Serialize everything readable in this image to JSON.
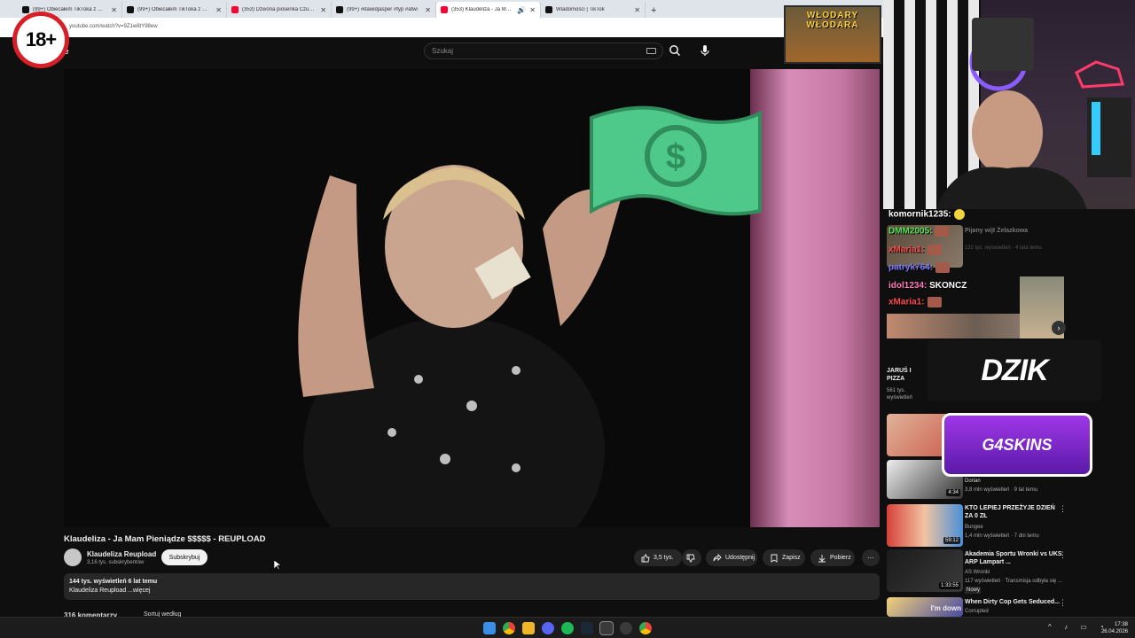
{
  "browser": {
    "tabs": [
      {
        "title": "(99+) Obiecałem TikToka z @La",
        "icon": "tiktok",
        "active": false
      },
      {
        "title": "(99+) Obiecałem TikToka z @La",
        "icon": "tiktok",
        "active": false
      },
      {
        "title": "(353) Dzwona piosenka Czukcza",
        "icon": "youtube",
        "active": false
      },
      {
        "title": "(99+) #dawidjasper #fyp #atwi",
        "icon": "tiktok",
        "active": false
      },
      {
        "title": "(353) Klaudeliza - Ja Mam P",
        "icon": "youtube",
        "active": true
      },
      {
        "title": "Wiadomości | TikTok",
        "icon": "tiktok",
        "active": false
      }
    ],
    "new_tab_label": "+",
    "url": "youtube.com/watch?v=9Z1w8tY98ew"
  },
  "overlay": {
    "age_badge": "18+",
    "banner_text": "WŁODARY WŁODARA",
    "dzik_logo": "DZIK",
    "g4skins_logo": "G4SKINS"
  },
  "youtube": {
    "logo_suffix": "e",
    "search_placeholder": "Szukaj",
    "video_title": "Klaudeliza - Ja Mam Pieniądze $$$$$ - REUPLOAD",
    "channel_name": "Klaudeliza Reupload",
    "channel_subs": "3,16 tys. subskrybentów",
    "subscribe_label": "Subskrybuj",
    "likes": "3,5 tys.",
    "share_label": "Udostępnij",
    "save_label": "Zapisz",
    "download_label": "Pobierz",
    "description_line1": "144 tys. wyświetleń  6 lat temu",
    "description_line2": "Klaudeliza Reupload ...więcej",
    "comments_label": "316 komentarzy",
    "sort_label": "Sortuj według"
  },
  "chat": [
    {
      "user": "komornik1235:",
      "color": "#ffffff"
    },
    {
      "user": "DMM2005:",
      "color": "#57e457"
    },
    {
      "user": "xMaria1:",
      "color": "#ff4b4b"
    },
    {
      "user": "patryk764:",
      "color": "#7b7bff"
    },
    {
      "user": "idol1234:",
      "color": "#ff7ab8",
      "message": "SKONCZ"
    },
    {
      "user": "xMaria1:",
      "color": "#ff4b4b"
    }
  ],
  "recommendations": [
    {
      "title": "Pijany wijt Żelazkowa",
      "meta": "132 tys. wyświetleń · 4 lata temu"
    },
    {
      "title": "JARUŚ I PIZZA",
      "meta": "561 tys. wyświetleń"
    },
    {
      "title": "",
      "channel": "Dorian",
      "meta": "3,8 mln wyświetleń · 9 lat temu",
      "duration": "4:34"
    },
    {
      "title": "KTO LEPIEJ PRZEŻYJE DZIEŃ ZA 0 ZŁ",
      "channel": "Bungee",
      "meta": "1,4 mln wyświetleń · 7 dni temu",
      "duration": "59:12"
    },
    {
      "title": "Akademia Sportu Wronki vs UKS ARP Lampart ...",
      "channel": "AS Wronki",
      "meta": "117 wyświetleń · Transmisja odbyła się ...",
      "badge": "Nowy",
      "duration": "1:33:55"
    },
    {
      "title": "When Dirty Cop Gets Seduced...",
      "channel": "Corrupted",
      "meta": "",
      "overlay": "I'm down"
    }
  ],
  "taskbar": {
    "time": "17:38",
    "date": "26.04.2026"
  },
  "colors": {
    "yt_bg": "#0f0f0f",
    "accent_red": "#ff0033",
    "subscribe_bg": "#f1f1f1",
    "pill_bg": "#272727"
  }
}
